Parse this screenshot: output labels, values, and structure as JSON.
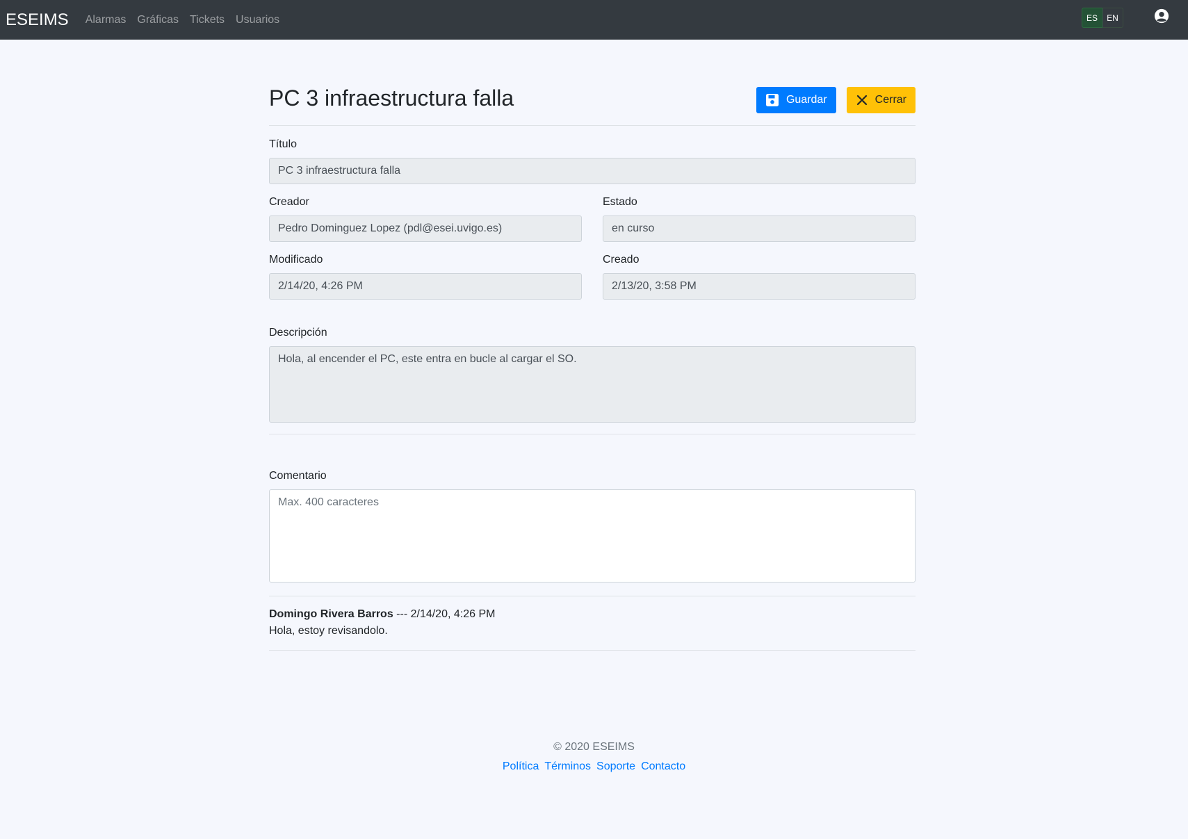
{
  "nav": {
    "brand": "ESEIMS",
    "links": [
      "Alarmas",
      "Gráficas",
      "Tickets",
      "Usuarios"
    ],
    "lang_es": "ES",
    "lang_en": "EN"
  },
  "ticket": {
    "title": "PC 3 infraestructura falla",
    "save_label": "Guardar",
    "close_label": "Cerrar"
  },
  "form": {
    "titulo_label": "Título",
    "titulo_value": "PC 3 infraestructura falla",
    "creador_label": "Creador",
    "creador_value": "Pedro Dominguez Lopez (pdl@esei.uvigo.es)",
    "estado_label": "Estado",
    "estado_value": "en curso",
    "modificado_label": "Modificado",
    "modificado_value": "2/14/20, 4:26 PM",
    "creado_label": "Creado",
    "creado_value": "2/13/20, 3:58 PM",
    "descripcion_label": "Descripción",
    "descripcion_value": "Hola, al encender el PC, este entra en bucle al cargar el SO.",
    "comentario_label": "Comentario",
    "comentario_placeholder": "Max. 400 caracteres"
  },
  "comments": [
    {
      "author": "Domingo Rivera Barros",
      "meta": " --- 2/14/20, 4:26 PM",
      "text": "Hola, estoy revisandolo."
    }
  ],
  "footer": {
    "copyright": "© 2020 ESEIMS",
    "links": [
      "Política",
      "Términos",
      "Soporte",
      "Contacto"
    ]
  },
  "colors": {
    "primary": "#007bff",
    "warning": "#ffc107",
    "navbar": "#343a40",
    "success": "#28a745"
  }
}
